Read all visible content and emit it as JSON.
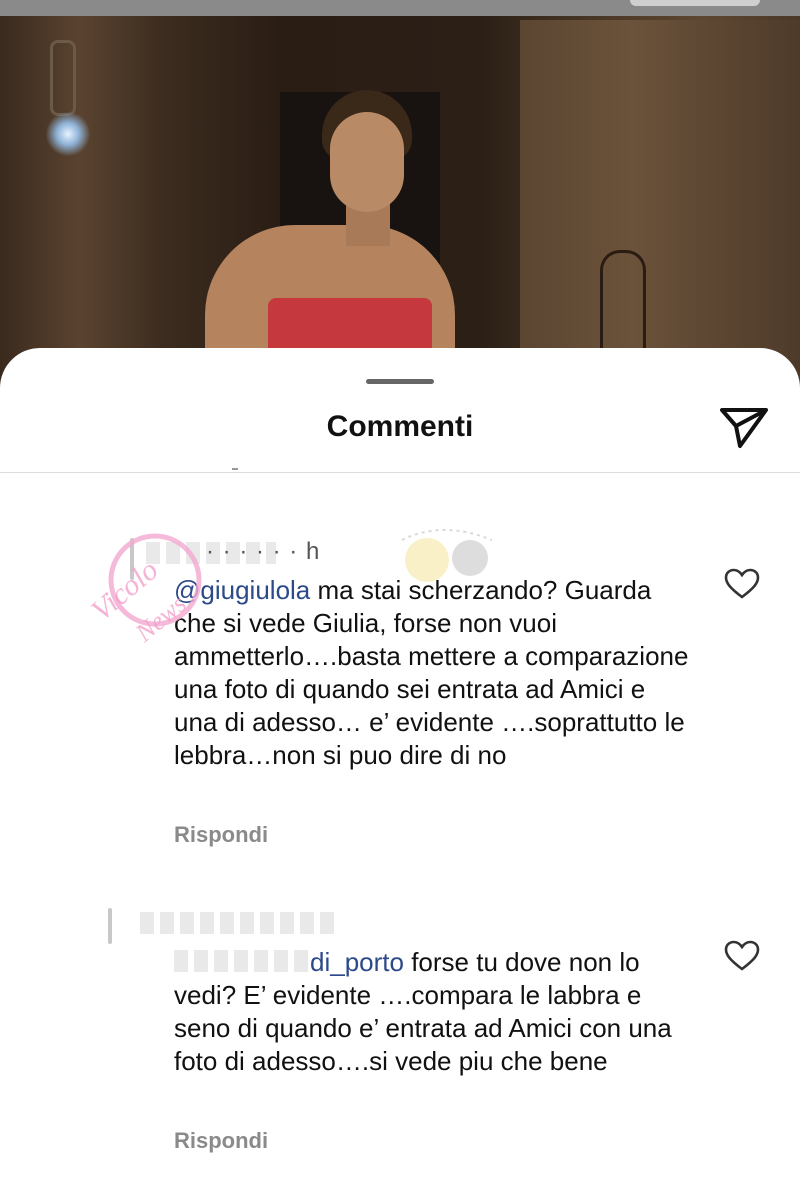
{
  "sheet": {
    "title": "Commenti"
  },
  "comments": [
    {
      "meta": "· · · · · · h",
      "mention": "@giugiulola",
      "text": " ma stai scherzando? Guarda che si vede Giulia, forse non vuoi ammetterlo….basta mettere a comparazione una foto di quando sei entrata ad Amici e una di adesso… e’ evidente ….soprattutto le lebbra…non si puo dire di no",
      "reply_label": "Rispondi"
    },
    {
      "mention": "di_porto",
      "text": " forse tu dove non lo vedi? E’ evidente ….compara le labbra e seno di quando e’ entrata ad Amici con una foto di adesso….si vede piu che bene",
      "reply_label": "Rispondi"
    }
  ],
  "watermark": {
    "text": "Vicolo delle News"
  },
  "icons": {
    "send": "send-paper-plane-icon",
    "like": "heart-outline-icon"
  }
}
